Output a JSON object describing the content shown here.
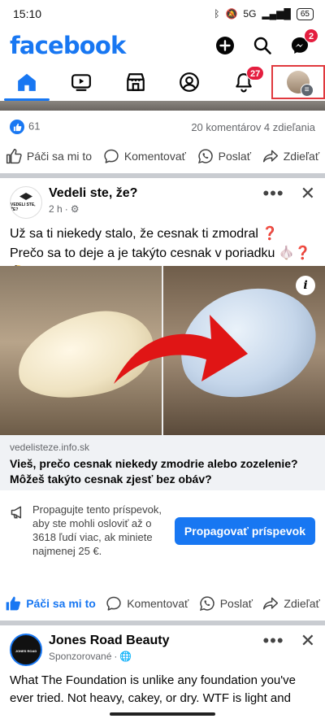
{
  "status_bar": {
    "time": "15:10",
    "battery": "65",
    "signal": "5G"
  },
  "header": {
    "logo": "facebook",
    "messenger_badge": "2"
  },
  "tabs": {
    "notifications_badge": "27"
  },
  "prev_post": {
    "likes": "61",
    "stats": "20 komentárov  4 zdieľania",
    "actions": {
      "like": "Páči sa mi to",
      "comment": "Komentovať",
      "send": "Poslať",
      "share": "Zdieľať"
    }
  },
  "post": {
    "page_name": "Vedeli ste, že?",
    "avatar_text": "VEDELI STE, ŽE?",
    "time": "2 h",
    "text": "Už sa ti niekedy stalo, že cesnak ti zmodral ❓ Prečo sa to deje a je takýto cesnak v poriadku 🧄❓🤔",
    "link_domain": "vedelisteze.info.sk",
    "link_title": "Vieš, prečo cesnak niekedy zmodrie alebo zozelenie? Môžeš takýto cesnak zjesť bez obáv?",
    "promo_text": "Propagujte tento príspevok, aby ste mohli osloviť až o 3618 ľudí viac, ak miniete najmenej 25 €.",
    "promo_button": "Propagovať príspevok",
    "actions": {
      "like": "Páči sa mi to",
      "comment": "Komentovať",
      "send": "Poslať",
      "share": "Zdieľať"
    }
  },
  "sponsored": {
    "page_name": "Jones Road Beauty",
    "avatar_text": "JONES ROAD",
    "label": "Sponzorované",
    "text": "What The Foundation is unlike any foundation you've ever tried. Not heavy, cakey, or dry. WTF is light and"
  }
}
